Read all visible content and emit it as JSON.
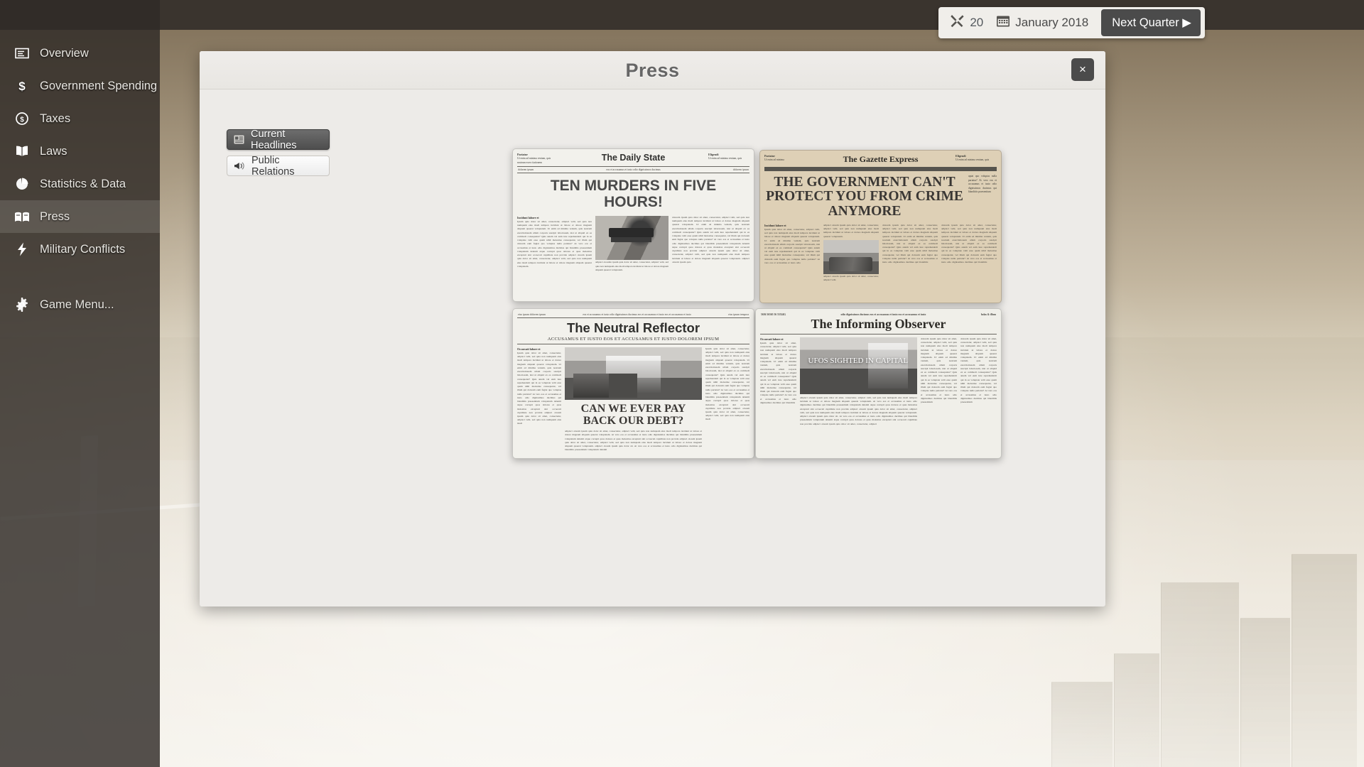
{
  "topbar": {
    "tools_icon": "tools-icon",
    "tools_value": "20",
    "calendar_icon": "calendar-icon",
    "date": "January 2018",
    "next_quarter_label": "Next Quarter ▶"
  },
  "sidebar": {
    "items": [
      {
        "label": "Overview",
        "icon": "overview-icon",
        "active": false
      },
      {
        "label": "Government Spending",
        "icon": "dollar-icon",
        "active": false
      },
      {
        "label": "Taxes",
        "icon": "coin-icon",
        "active": false
      },
      {
        "label": "Laws",
        "icon": "book-icon",
        "active": false
      },
      {
        "label": "Statistics & Data",
        "icon": "pie-chart-icon",
        "active": false
      },
      {
        "label": "Press",
        "icon": "newspaper-icon",
        "active": true
      },
      {
        "label": "Military Conflicts",
        "icon": "lightning-icon",
        "active": false
      }
    ],
    "game_menu": {
      "label": "Game Menu...",
      "icon": "gear-icon"
    }
  },
  "dialog": {
    "title": "Press",
    "close_label": "×",
    "tabs": [
      {
        "label": "Current Headlines",
        "icon": "newspaper-icon",
        "active": true
      },
      {
        "label": "Public Relations",
        "icon": "megaphone-icon",
        "active": false
      }
    ]
  },
  "newspapers": [
    {
      "id": "daily-state",
      "name": "The Daily State",
      "headline": "TEN MURDERS IN FIVE HOURS!",
      "paper_color": "#f2f1ec",
      "left_blurb_title": "Pariatur",
      "left_blurb_text": "Ut enim ad minima veniam, quis nostrum exerc itationem",
      "right_blurb_title": "Eligendi",
      "right_blurb_text": "Ut enim ad minima veniam, quis",
      "strip_left": "dolorem ipsum",
      "strip_mid": "eos et accusamus et iusto odio dignissimos ducimus",
      "strip_right": "dolorem ipsum",
      "lead": "Incidunt labore et",
      "photo": "gun-photo",
      "photo_caption": "adipisci oloremn ipsum quia dolor sit amet, consectetur, adipisci velit, sed quia non numquam eius modi tempora incidunt ut labore et dolore magnam aliquam quaerat voluptatem.",
      "body": "Ipsum quia dolor sit amet, consectetur, adipisci velit, sed quia non numquam eius modi tempora incidunt ut labore et dolore magnam aliquam quaerat voluptatem. Ut enim ad minima veniam, quis nostrum exercitationem ullam corporis suscipit laboriosam, nisi ut aliquid ex ea commodi consequatur? Quis autem vel eum iure reprehenderit qui in ea voluptate velit esse quam nihil molestiae consequatur, vel illum qui dolorem eum fugiat quo voluptas nulla pariatur? At vero eos et accusamus et iusto odio dignissimos ducimus qui blanditiis praesentium voluptatum deleniti atque corrupti quos dolores et quas molestias excepturi sint occaecati cupiditate non provide adipisci olorem ipsum quia dolor sit amet, consectetur, adipisci velit, sed quia non numquam eius modi tempora incidunt ut labore et dolore magnam aliquam quaerat voluptatem.",
      "body_right": "dolorem ipsum quia dolor sit amet, consectetur, adipisci velit, sed quia non numquam eius modi tempora incidunt ut labore et dolore magnam aliquam quaerat voluptatem. Ut enim ad minima veniam, quis nostrum exercitationem ullam corporis suscipit laboriosam, nisi ut aliquid ex ea commodi consequatur? Quis autem vel eum iure reprehenderit qui in ea voluptate velit esse quam nihil molestiae consequatur, vel illum qui dolorem eum fugiat quo voluptas nulla pariatur? At vero eos et accusamus et iusto odio dignissimos ducimus qui blanditiis praesentium voluptatum deleniti atque corrupti quos dolores et quas molestias excepturi sint occaecati cupiditate non provide adipisci olorem ipsum quia dolor sit amet, consectetur, adipisci velit, sed quia non numquam eius modi tempora incidunt ut labore et dolore magnam aliquam quaerat voluptatem. adipisci olorem ipsum quia"
    },
    {
      "id": "gazette-express",
      "name": "The Gazette Express",
      "headline": "THE GOVERNMENT CAN'T PROTECT YOU FROM CRIME ANYMORE",
      "paper_color": "#ded0b6",
      "left_blurb_title": "Pariatur",
      "left_blurb_text": "Ut enim ad minima",
      "right_blurb_title": "Eligendi",
      "right_blurb_text": "Ut enim ad minima veniam, quis",
      "side_column": "uptat quo voluptas nulla pariatur? At vero eos et accusamus et iusto odio dignissimos ducimus qui blanditiis praesentium",
      "lead": "Incidunt labore et",
      "photo": "tank-photo",
      "photo_caption": "adipisci olorem ipsum quia dolor sit amet, consectetur, adipisci velit.",
      "body": "Ipsum quia dolor sit amet, consectetur, adipisci velit, sed quia non numquam eius modi tempora incidunt ut labore et dolore magnam aliquam quaerat voluptatem. Ut enim ad minima veniam, quis nostrum exercitationem ullam corporis suscipit laboriosam, nisi ut aliquid ex ea commodi consequatur? Quis autem vel eum iure reprehenderit qui in ea voluptate velit esse quam nihil molestiae consequatur, vel illum qui dolorem eum fugiat quo voluptas nulla pariatur? At vero eos et accusamus et iusto odio",
      "body_col2": "adipisci olorem ipsum quia dolor sit amet, consectetur, adipisci velit, sed quia non numquam eius modi tempora incidunt ut labore et dolore magnam aliquam quaerat voluptatem.",
      "body_col3": "dolorem ipsum quia dolor sit amet, consectetur, adipisci velit, sed quia non numquam eius modi tempora incidunt ut labore et dolore magnam aliquam quaerat voluptatem. Ut enim ad minima veniam, quis nostrum exercitationem ullam corporis suscipit laboriosam, nisi ut aliquid ex ea commodi consequatur? Quis autem vel eum iure reprehenderit qui in ea voluptate velit esse quam nihil molestiae consequatur, vel illum qui dolorem eum fugiat quo voluptas nulla pariatur? At vero eos et accusamus et iusto odio dignissimos ducimus qui blanditiis"
    },
    {
      "id": "neutral-reflector",
      "name": "The Neutral Reflector",
      "subtitle": "ACCUSAMUS ET IUSTO EOS ET ACCUSAMUS ET IUSTO DOLOREM IPSUM",
      "headline": "CAN WE EVER PAY BACK OUR DEBT?",
      "paper_color": "#f2f1ec",
      "strip_left": "eius ipsum dolorem ipsum",
      "strip_mid": "eos et accusamus et iusto odio dignissimos ducimus eos et accusamus et iusto eos et accusamus et iusto",
      "strip_right": "eius ipsum tempora",
      "lead": "Occaecati labore et",
      "photo": "street-photo",
      "body": "Ipsum quia dolor sit amet, consectetur, adipisci velit, sed quia non numquam eius modi tempora incidunt ut labore et dolore magnam aliquam quaerat voluptatem. Ut enim ad minima veniam, quis nostrum exercitationem ullam corporis suscipit laboriosam, nisi ut aliquid ex ea commodi consequatur? Quis autem vel eum iure reprehenderit qui in ea voluptate velit esse quam nihil molestiae consequatur, vel illum qui dolorem eum fugiat quo voluptas nulla pariatur? At vero eos et accusamus et iusto odio dignissimos ducimus qui blanditiis praesentium voluptatum deleniti atque corrupti quos dolores et quas molestias excepturi sint occaecati cupiditate non provide adipisci olorem ipsum quia dolor sit amet, consectetur, adipisci velit, sed quia non numquam eius modi",
      "body_bottom": "adipisci olorem ipsum quia dolor sit amet, consectetur, adipisci velit, sed quia non numquam eius modi tempora incidunt ut labore et dolore magnam aliquam quaerat voluptatem. At vero eos et accusamus et iusto odio dignissimos ducimus qui blanditiis praesentium voluptatum deleniti atque corrupti quos dolores et quas molestias excepturi sint occaecati cupiditate non provide adipisci olorem ipsum quia dolor sit amet, consectetur, adipisci velit, sed quia non numquam eius modi tempora incidunt ut labore et dolore magnam aliquam quaerat voluptatem. adipisci olorem ipsum quia dolor sit. At vero eos et accusamus et iusto odio dignissimos ducimus qui blanditiis praesentium voluptatum deleniti"
    },
    {
      "id": "informing-observer",
      "name": "The Informing Observer",
      "headline": "UFOS SIGHTED IN CAPITAL",
      "paper_color": "#f0efe9",
      "strip_left": "5656 56565 56 55524G",
      "strip_mid": "odio dignissimos ducimus eos et accusamus et iusto eos et accusamus et iusto",
      "strip_right": "holas & illum",
      "lead": "Occaecati labore et",
      "photo": "city-photo",
      "body": "Ipsum quia dolor sit amet, consectetur, adipisci velit, sed quia non numquam eius modi tempora incidunt ut labore et dolore magnam aliquam quaerat voluptatem. Ut enim ad minima veniam, quis nostrum exercitationem ullam corporis suscipit laboriosam, nisi ut aliquid ex ea commodi consequatur? Quis autem vel eum iure reprehenderit qui in ea voluptate velit esse quam nihil molestiae consequatur, vel illum qui dolorem eum fugiat quo voluptas nulla pariatur? At vero eos et accusamus et iusto odio dignissimos ducimus qui blanditiis",
      "body_bottom": "adipisci olorem ipsum quia dolor sit amet, consectetur, adipisci velit, sed quia non numquam eius modi tempora incidunt ut labore et dolore magnam aliquam quaerat voluptatem. At vero eos et accusamus et iusto odio dignissimos ducimus qui blanditiis praesentium voluptatum deleniti atque corrupti quos dolores et quas molestias excepturi sint occaecati cupiditate non provide adipisci olorem ipsum quia dolor sit amet, consectetur, adipisci velit, sed quia non numquam eius modi tempora incidunt ut labore et dolore magnam aliquam quaerat voluptatem. adipisci olorem ipsum quia dolor sit. At vero eos et accusamus et iusto odio dignissimos ducimus qui blanditiis praesentium voluptatum deleniti atque corrupti quos dolores et quas molestias excepturi sint occaecati cupiditate non provide adipisci olorem ipsum quia dolor sit amet, consectetur, adipisci",
      "body_right": "dolorem ipsum quia dolor sit amet, consectetur, adipisci velit, sed quia non numquam eius modi tempora incidunt ut labore et dolore magnam aliquam quaerat voluptatem. Ut enim ad minima veniam, quis nostrum exercitationem ullam corporis suscipit laboriosam, nisi ut aliquid ex ea commodi consequatur? Quis autem vel eum iure reprehenderit qui in ea voluptate velit esse quam nihil molestiae consequatur, vel illum qui dolorem eum fugiat quo voluptas nulla pariatur? At vero eos et accusamus et iusto odio dignissimos ducimus qui blanditiis praesentium"
    }
  ],
  "colors": {
    "background_brown": "#6b5b46",
    "sidebar": "#302b27",
    "dialog": "#edebe8",
    "accent_dark": "#4b4b4b",
    "gazette_paper": "#ded0b6"
  }
}
